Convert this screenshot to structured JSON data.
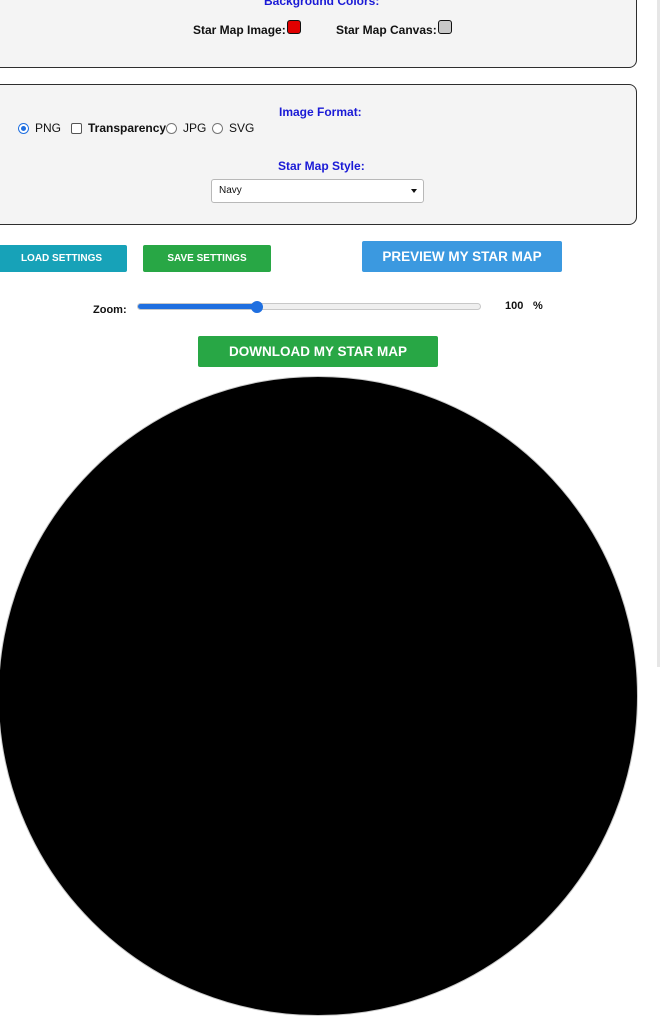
{
  "background_colors": {
    "title": "Background Colors:",
    "star_map_image_label": "Star Map Image:",
    "star_map_image_color": "#e00000",
    "star_map_canvas_label": "Star Map Canvas:",
    "star_map_canvas_color": "#c8c8c8"
  },
  "image_format": {
    "title": "Image Format:",
    "options": [
      {
        "label": "PNG",
        "checked": true
      },
      {
        "label": "Transparency",
        "checked": false
      },
      {
        "label": "JPG",
        "checked": false
      },
      {
        "label": "SVG",
        "checked": false
      }
    ]
  },
  "star_map_style": {
    "title": "Star Map Style:",
    "selected": "Navy"
  },
  "buttons": {
    "load_settings": "LOAD SETTINGS",
    "save_settings": "SAVE SETTINGS",
    "preview": "PREVIEW MY STAR MAP",
    "download": "DOWNLOAD MY STAR MAP"
  },
  "zoom": {
    "label": "Zoom:",
    "value": "100",
    "unit": "%",
    "slider_fraction": 0.35
  },
  "colors": {
    "accent_blue": "#1f6fe0",
    "load_button": "#17a2b8",
    "green_button": "#28a745",
    "preview_button": "#3b99e0",
    "starmap_fill": "#000000"
  }
}
